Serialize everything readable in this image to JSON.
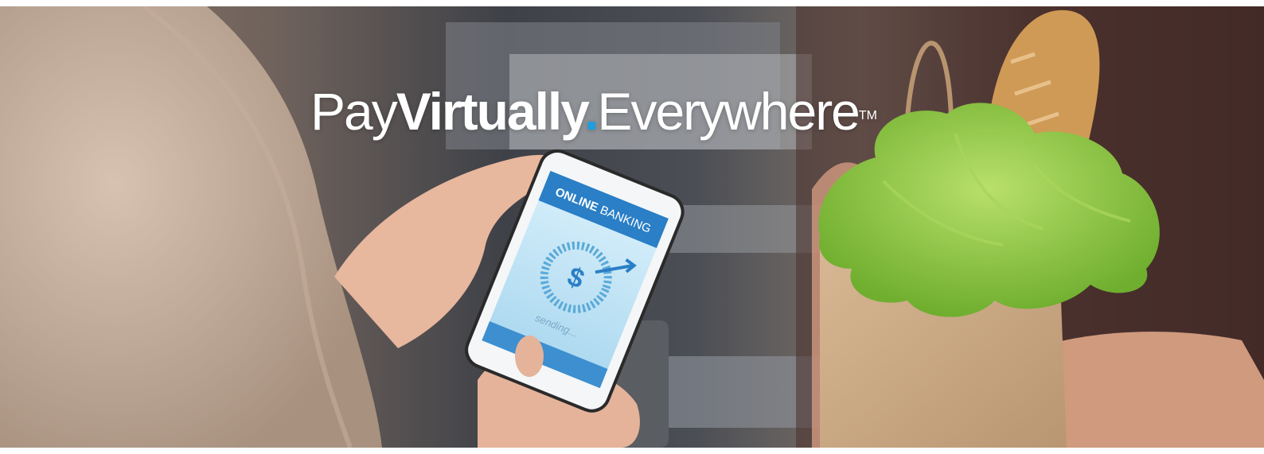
{
  "hero": {
    "headline": {
      "part1": "Pay",
      "part2": "Virtually",
      "dot": ".",
      "part3": "Everywhere",
      "trademark": "TM"
    },
    "phone_screen": {
      "header_bold": "ONLINE",
      "header_light": "BANKING",
      "currency_symbol": "$",
      "status": "sending..."
    }
  },
  "colors": {
    "brand_blue": "#1e9ee0",
    "headline_text": "#ffffff",
    "phone_header": "#2a7fc6",
    "phone_screen": "#bfe3f5",
    "lettuce": "#8cc63e",
    "paper_bag": "#c9a683"
  }
}
